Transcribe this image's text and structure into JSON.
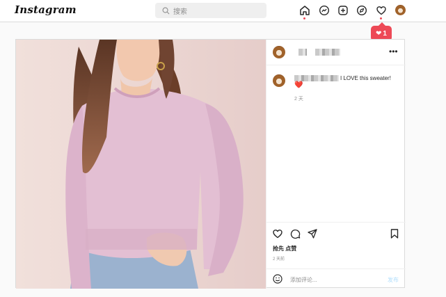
{
  "nav": {
    "logo": "Instagram",
    "search_placeholder": "搜索",
    "icons": [
      "home-icon",
      "messenger-icon",
      "new-post-icon",
      "explore-icon",
      "activity-heart-icon",
      "profile-avatar"
    ],
    "notification_count": "1",
    "accent": "#ed4956"
  },
  "post": {
    "comment": {
      "text": "I LOVE this sweater!",
      "emoji": "❤️",
      "time": "2 天"
    },
    "likes_label": "抢先 点赞",
    "time": "2 天前",
    "add_comment_placeholder": "添加评论...",
    "post_button": "发布"
  }
}
